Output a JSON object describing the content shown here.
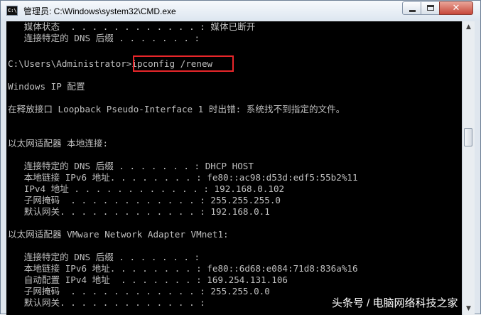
{
  "window": {
    "title": "管理员: C:\\Windows\\system32\\CMD.exe",
    "icon": "cmd-icon",
    "close_glyph": "✕"
  },
  "console": {
    "lines": [
      "   媒体状态  . . . . . . . . . . . . : 媒体已断开",
      "   连接特定的 DNS 后缀 . . . . . . . :",
      "",
      "C:\\Users\\Administrator>ipconfig /renew",
      "",
      "Windows IP 配置",
      "",
      "在释放接口 Loopback Pseudo-Interface 1 时出错: 系统找不到指定的文件。",
      "",
      "",
      "以太网适配器 本地连接:",
      "",
      "   连接特定的 DNS 后缀 . . . . . . . : DHCP HOST",
      "   本地链接 IPv6 地址. . . . . . . . : fe80::ac98:d53d:edf5:55b2%11",
      "   IPv4 地址 . . . . . . . . . . . . : 192.168.0.102",
      "   子网掩码  . . . . . . . . . . . . : 255.255.255.0",
      "   默认网关. . . . . . . . . . . . . : 192.168.0.1",
      "",
      "以太网适配器 VMware Network Adapter VMnet1:",
      "",
      "   连接特定的 DNS 后缀 . . . . . . . :",
      "   本地链接 IPv6 地址. . . . . . . . : fe80::6d68:e084:71d8:836a%16",
      "   自动配置 IPv4 地址  . . . . . . . : 169.254.131.106",
      "   子网掩码  . . . . . . . . . . . . : 255.255.0.0",
      "   默认网关. . . . . . . . . . . . . :"
    ],
    "highlighted_command": "ipconfig /renew",
    "text_color": "#c0c0c0",
    "background_color": "#000000"
  },
  "scrollbar": {
    "up_arrow": "▲",
    "down_arrow": "▼"
  },
  "watermark": {
    "text": "头条号 / 电脑网络科技之家"
  },
  "colors": {
    "highlight_border": "#e8262a"
  }
}
